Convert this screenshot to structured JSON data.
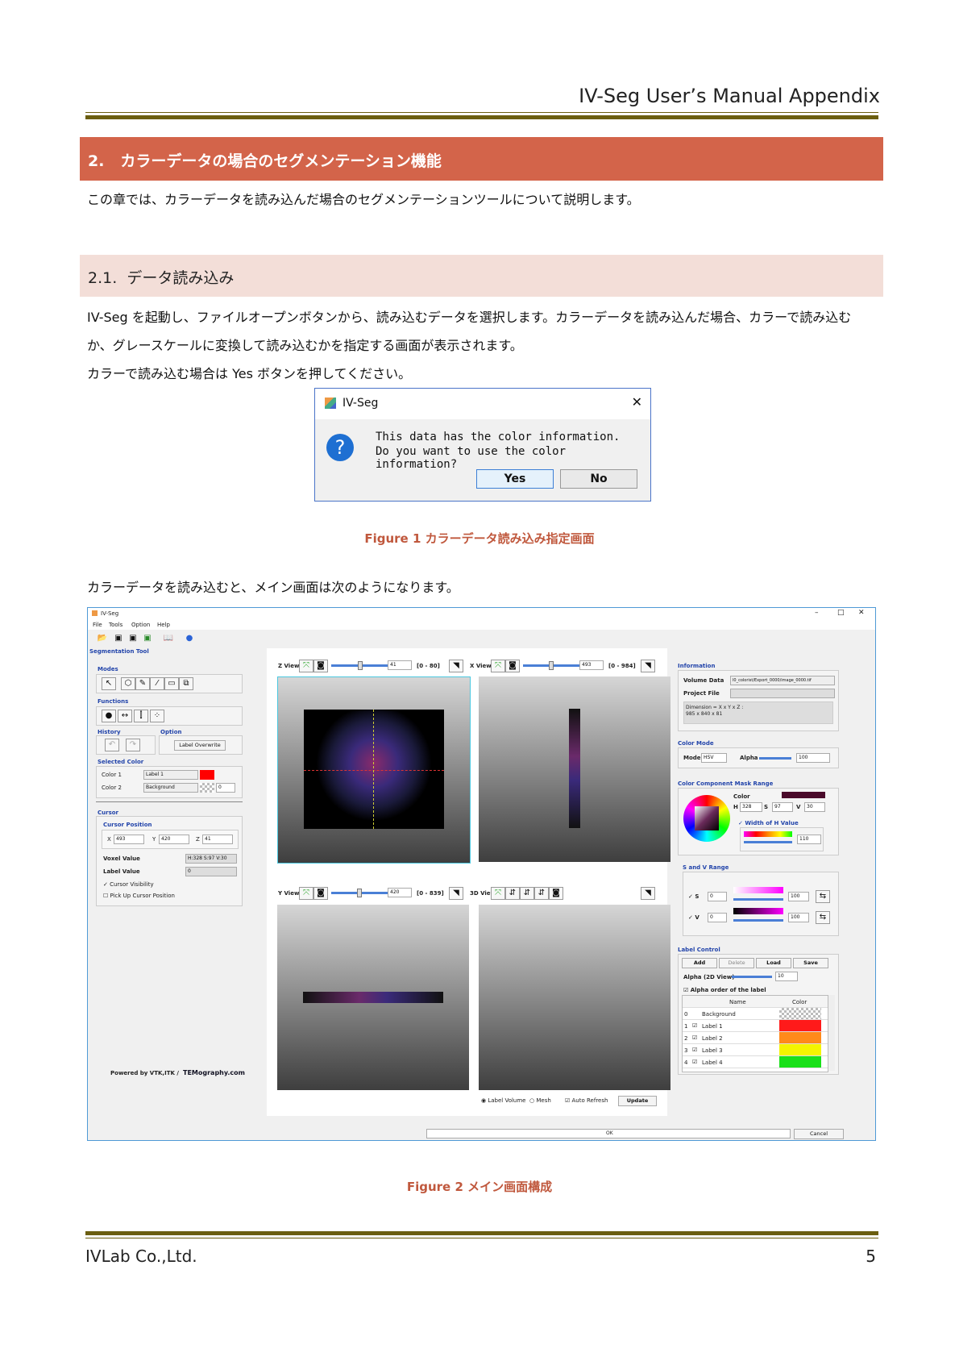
{
  "header": {
    "title": "IV-Seg User’s Manual Appendix"
  },
  "section2": {
    "number": "2.",
    "title": "カラーデータの場合のセグメンテーション機能",
    "intro": "この章では、カラーデータを読み込んだ場合のセグメンテーションツールについて説明します。"
  },
  "section21": {
    "number": "2.1.",
    "title": "データ読み込み",
    "para1_line1": "IV-Seg を起動し、ファイルオープンボタンから、読み込むデータを選択します。カラーデータを読み込んだ場合、カラーで読み込む",
    "para1_line2": "か、グレースケールに変換して読み込むかを指定する画面が表示されます。",
    "para2": "カラーで読み込む場合は Yes ボタンを押してください。",
    "para3": "カラーデータを読み込むと、メイン画面は次のようになります。"
  },
  "dialog": {
    "title": "IV-Seg",
    "line1": "This data has the color information.",
    "line2": "Do you want to use the color information?",
    "yes": "Yes",
    "no": "No",
    "close": "✕",
    "question": "?"
  },
  "figure1": {
    "caption": "Figure 1  カラーデータ読み込み指定画面"
  },
  "figure2": {
    "caption": "Figure 2  メイン画面構成"
  },
  "app": {
    "title": "IV-Seg",
    "menu": [
      "File",
      "Tools",
      "Option",
      "Help"
    ],
    "panel_title": "Segmentation Tool",
    "modes": "Modes",
    "functions": "Functions",
    "history": "History",
    "option": "Option",
    "label_overwrite": "Label Overwrite",
    "selected_color": "Selected Color",
    "color1": "Color 1",
    "color1_value": "Label 1",
    "color2": "Color 2",
    "color2_value": "Background",
    "color2_num": "0",
    "cursor": "Cursor",
    "cursor_position": "Cursor Position",
    "x_label": "X",
    "x_val": "493",
    "y_label": "Y",
    "y_val": "420",
    "z_label": "Z",
    "z_val": "41",
    "voxel_value": "Voxel Value",
    "voxel_val": "H:328 S:97 V:30",
    "label_value": "Label Value",
    "label_val": "0",
    "cursor_visibility": "Cursor Visibility",
    "pickup": "Pick Up Cursor Position",
    "powered": "Powered by VTK,ITK /",
    "temography": "TEMography.com",
    "zview": "Z View",
    "zval": "41",
    "zrange": "[0 - 80]",
    "xview": "X View",
    "xval": "493",
    "xrange": "[0 - 984]",
    "yview": "Y View",
    "yval": "420",
    "yrange": "[0 - 839]",
    "view3d": "3D View",
    "label_volume": "Label Volume",
    "mesh": "Mesh",
    "auto_refresh": "Auto Refresh",
    "update": "Update",
    "information": "Information",
    "volume_data": "Volume Data",
    "volume_path": "l0_colorist/Export_0000/image_0000.tif",
    "project_file": "Project File",
    "dimension": "Dimension = X x Y x Z :",
    "dimension_val": "985 x 840 x 81",
    "color_mode": "Color Mode",
    "mode": "Mode",
    "mode_val": "HSV",
    "alpha": "Alpha",
    "alpha_val": "100",
    "mask_range": "Color Component Mask Range",
    "color": "Color",
    "h_label": "H",
    "h_val": "328",
    "s_label": "S",
    "s_val": "97",
    "v_label": "V",
    "v_val": "30",
    "width_h": "Width of H Value",
    "width_h_val": "110",
    "sv_range": "S and V Range",
    "s_row": "S",
    "s_min": "0",
    "s_max": "100",
    "v_row": "V",
    "v_min": "0",
    "v_max": "100",
    "label_control": "Label Control",
    "add": "Add",
    "delete": "Delete",
    "load": "Load",
    "save": "Save",
    "alpha2d": "Alpha (2D View)",
    "alpha2d_val": "10",
    "alpha_order": "Alpha order of the label",
    "col_name": "Name",
    "col_color": "Color",
    "labels": [
      {
        "idx": "0",
        "name": "Background",
        "color": "#d8d8d8"
      },
      {
        "idx": "1",
        "name": "Label 1",
        "color": "#ff1a1a"
      },
      {
        "idx": "2",
        "name": "Label 2",
        "color": "#ff8a1a"
      },
      {
        "idx": "3",
        "name": "Label 3",
        "color": "#f4f400"
      },
      {
        "idx": "4",
        "name": "Label 4",
        "color": "#19e019"
      }
    ],
    "ok": "OK",
    "cancel": "Cancel"
  },
  "footer": {
    "company": "IVLab Co.,Ltd.",
    "page": "5"
  },
  "colors": {
    "section_bar": "#d3644a",
    "subsection_bar": "#f3ded8",
    "rule": "#6b5e10",
    "caption": "#c0583d"
  }
}
